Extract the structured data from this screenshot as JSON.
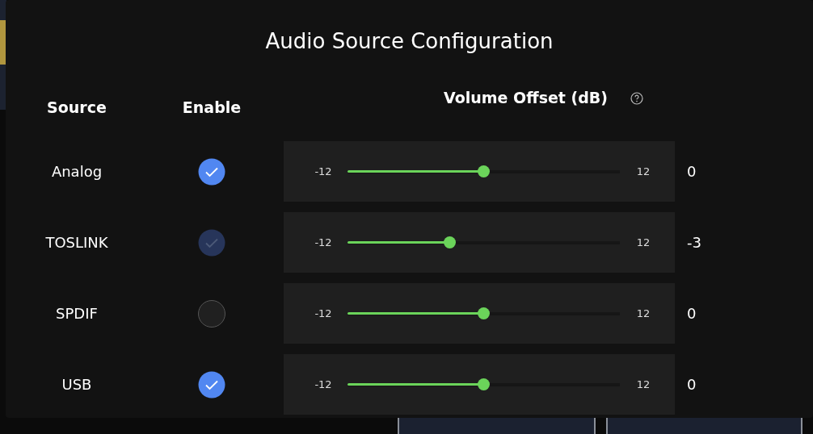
{
  "dialog": {
    "title": "Audio Source Configuration"
  },
  "columns": {
    "source": "Source",
    "enable": "Enable",
    "volume": "Volume Offset (dB)"
  },
  "sources": [
    {
      "name": "Analog",
      "checked": true,
      "disabled": false,
      "min": "-12",
      "max": "12",
      "level": 0.5,
      "reading": "0"
    },
    {
      "name": "TOSLINK",
      "checked": true,
      "disabled": true,
      "min": "-12",
      "max": "12",
      "level": 0.375,
      "reading": "-3"
    },
    {
      "name": "SPDIF",
      "checked": false,
      "disabled": false,
      "min": "-12",
      "max": "12",
      "level": 0.5,
      "reading": "0"
    },
    {
      "name": "USB",
      "checked": true,
      "disabled": false,
      "min": "-12",
      "max": "12",
      "level": 0.5,
      "reading": "0"
    }
  ]
}
